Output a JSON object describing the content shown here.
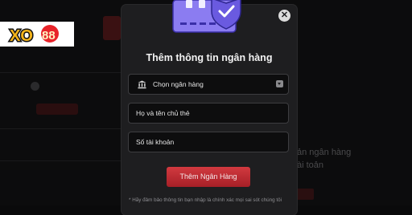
{
  "brand": {
    "logo_text": "XO88"
  },
  "modal": {
    "title": "Thêm thông tin ngân hàng",
    "bank_select": {
      "value": "Chọn ngân hàng",
      "icon": "bank-icon"
    },
    "name_field": {
      "placeholder": "Họ và tên chủ thẻ"
    },
    "account_field": {
      "placeholder": "Số tài khoản"
    },
    "submit_label": "Thêm Ngân Hàng",
    "note": "* Hãy đảm bảo thông tin bạn nhập là chính xác mọi sai sót chúng tôi",
    "close_icon": "close-icon"
  },
  "background": {
    "right_text_1": "ản ngân hàng",
    "right_text_2": "ài toản"
  },
  "colors": {
    "accent": "#c8303a",
    "modal_bg": "#1e1e20",
    "page_bg": "#0c0c0d",
    "logo_red": "#e8242a",
    "logo_gold": "#f4b41a"
  }
}
